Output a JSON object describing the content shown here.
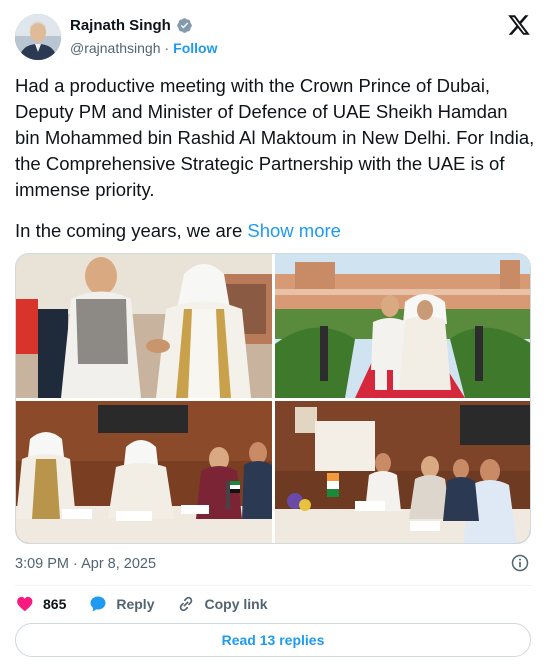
{
  "author": {
    "name": "Rajnath Singh",
    "handle": "@rajnathsingh",
    "separator": "·",
    "follow_label": "Follow"
  },
  "tweet": {
    "text": "Had a productive meeting with the Crown Prince of Dubai, Deputy PM and Minister of Defence of UAE Sheikh Hamdan bin Mohammed bin Rashid Al Maktoum in New Delhi. For India, the Comprehensive Strategic Partnership with the UAE is of immense priority.",
    "text_continued": "In the coming years, we are",
    "show_more_label": "Show more"
  },
  "media": {
    "images": [
      {
        "description": "handshake-photo"
      },
      {
        "description": "walk-photo"
      },
      {
        "description": "uae-delegation-photo"
      },
      {
        "description": "india-delegation-photo"
      }
    ]
  },
  "timestamp": "3:09 PM · Apr 8, 2025",
  "actions": {
    "like_count": "865",
    "reply_label": "Reply",
    "copy_link_label": "Copy link"
  },
  "read_replies_label": "Read 13 replies",
  "colors": {
    "accent": "#1d9bf0",
    "like": "#f91880",
    "secondary_text": "#536471"
  }
}
